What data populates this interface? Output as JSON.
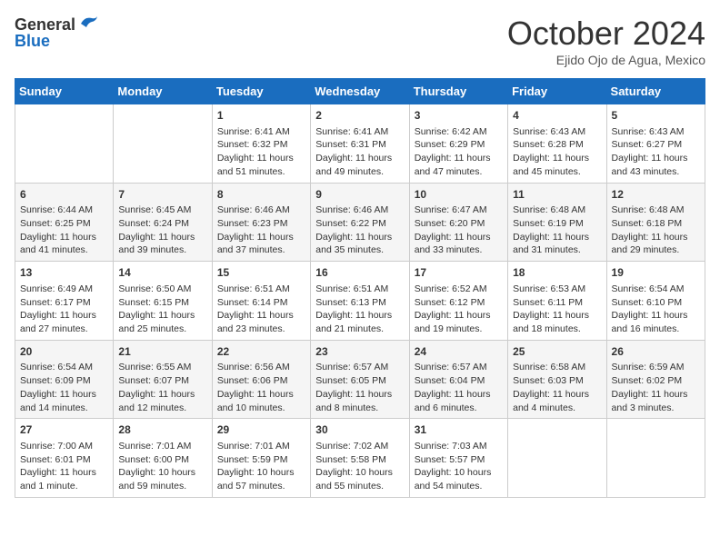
{
  "logo": {
    "general": "General",
    "blue": "Blue"
  },
  "title": "October 2024",
  "location": "Ejido Ojo de Agua, Mexico",
  "weekdays": [
    "Sunday",
    "Monday",
    "Tuesday",
    "Wednesday",
    "Thursday",
    "Friday",
    "Saturday"
  ],
  "weeks": [
    [
      {
        "day": "",
        "content": ""
      },
      {
        "day": "",
        "content": ""
      },
      {
        "day": "1",
        "content": "Sunrise: 6:41 AM\nSunset: 6:32 PM\nDaylight: 11 hours and 51 minutes."
      },
      {
        "day": "2",
        "content": "Sunrise: 6:41 AM\nSunset: 6:31 PM\nDaylight: 11 hours and 49 minutes."
      },
      {
        "day": "3",
        "content": "Sunrise: 6:42 AM\nSunset: 6:29 PM\nDaylight: 11 hours and 47 minutes."
      },
      {
        "day": "4",
        "content": "Sunrise: 6:43 AM\nSunset: 6:28 PM\nDaylight: 11 hours and 45 minutes."
      },
      {
        "day": "5",
        "content": "Sunrise: 6:43 AM\nSunset: 6:27 PM\nDaylight: 11 hours and 43 minutes."
      }
    ],
    [
      {
        "day": "6",
        "content": "Sunrise: 6:44 AM\nSunset: 6:25 PM\nDaylight: 11 hours and 41 minutes."
      },
      {
        "day": "7",
        "content": "Sunrise: 6:45 AM\nSunset: 6:24 PM\nDaylight: 11 hours and 39 minutes."
      },
      {
        "day": "8",
        "content": "Sunrise: 6:46 AM\nSunset: 6:23 PM\nDaylight: 11 hours and 37 minutes."
      },
      {
        "day": "9",
        "content": "Sunrise: 6:46 AM\nSunset: 6:22 PM\nDaylight: 11 hours and 35 minutes."
      },
      {
        "day": "10",
        "content": "Sunrise: 6:47 AM\nSunset: 6:20 PM\nDaylight: 11 hours and 33 minutes."
      },
      {
        "day": "11",
        "content": "Sunrise: 6:48 AM\nSunset: 6:19 PM\nDaylight: 11 hours and 31 minutes."
      },
      {
        "day": "12",
        "content": "Sunrise: 6:48 AM\nSunset: 6:18 PM\nDaylight: 11 hours and 29 minutes."
      }
    ],
    [
      {
        "day": "13",
        "content": "Sunrise: 6:49 AM\nSunset: 6:17 PM\nDaylight: 11 hours and 27 minutes."
      },
      {
        "day": "14",
        "content": "Sunrise: 6:50 AM\nSunset: 6:15 PM\nDaylight: 11 hours and 25 minutes."
      },
      {
        "day": "15",
        "content": "Sunrise: 6:51 AM\nSunset: 6:14 PM\nDaylight: 11 hours and 23 minutes."
      },
      {
        "day": "16",
        "content": "Sunrise: 6:51 AM\nSunset: 6:13 PM\nDaylight: 11 hours and 21 minutes."
      },
      {
        "day": "17",
        "content": "Sunrise: 6:52 AM\nSunset: 6:12 PM\nDaylight: 11 hours and 19 minutes."
      },
      {
        "day": "18",
        "content": "Sunrise: 6:53 AM\nSunset: 6:11 PM\nDaylight: 11 hours and 18 minutes."
      },
      {
        "day": "19",
        "content": "Sunrise: 6:54 AM\nSunset: 6:10 PM\nDaylight: 11 hours and 16 minutes."
      }
    ],
    [
      {
        "day": "20",
        "content": "Sunrise: 6:54 AM\nSunset: 6:09 PM\nDaylight: 11 hours and 14 minutes."
      },
      {
        "day": "21",
        "content": "Sunrise: 6:55 AM\nSunset: 6:07 PM\nDaylight: 11 hours and 12 minutes."
      },
      {
        "day": "22",
        "content": "Sunrise: 6:56 AM\nSunset: 6:06 PM\nDaylight: 11 hours and 10 minutes."
      },
      {
        "day": "23",
        "content": "Sunrise: 6:57 AM\nSunset: 6:05 PM\nDaylight: 11 hours and 8 minutes."
      },
      {
        "day": "24",
        "content": "Sunrise: 6:57 AM\nSunset: 6:04 PM\nDaylight: 11 hours and 6 minutes."
      },
      {
        "day": "25",
        "content": "Sunrise: 6:58 AM\nSunset: 6:03 PM\nDaylight: 11 hours and 4 minutes."
      },
      {
        "day": "26",
        "content": "Sunrise: 6:59 AM\nSunset: 6:02 PM\nDaylight: 11 hours and 3 minutes."
      }
    ],
    [
      {
        "day": "27",
        "content": "Sunrise: 7:00 AM\nSunset: 6:01 PM\nDaylight: 11 hours and 1 minute."
      },
      {
        "day": "28",
        "content": "Sunrise: 7:01 AM\nSunset: 6:00 PM\nDaylight: 10 hours and 59 minutes."
      },
      {
        "day": "29",
        "content": "Sunrise: 7:01 AM\nSunset: 5:59 PM\nDaylight: 10 hours and 57 minutes."
      },
      {
        "day": "30",
        "content": "Sunrise: 7:02 AM\nSunset: 5:58 PM\nDaylight: 10 hours and 55 minutes."
      },
      {
        "day": "31",
        "content": "Sunrise: 7:03 AM\nSunset: 5:57 PM\nDaylight: 10 hours and 54 minutes."
      },
      {
        "day": "",
        "content": ""
      },
      {
        "day": "",
        "content": ""
      }
    ]
  ]
}
